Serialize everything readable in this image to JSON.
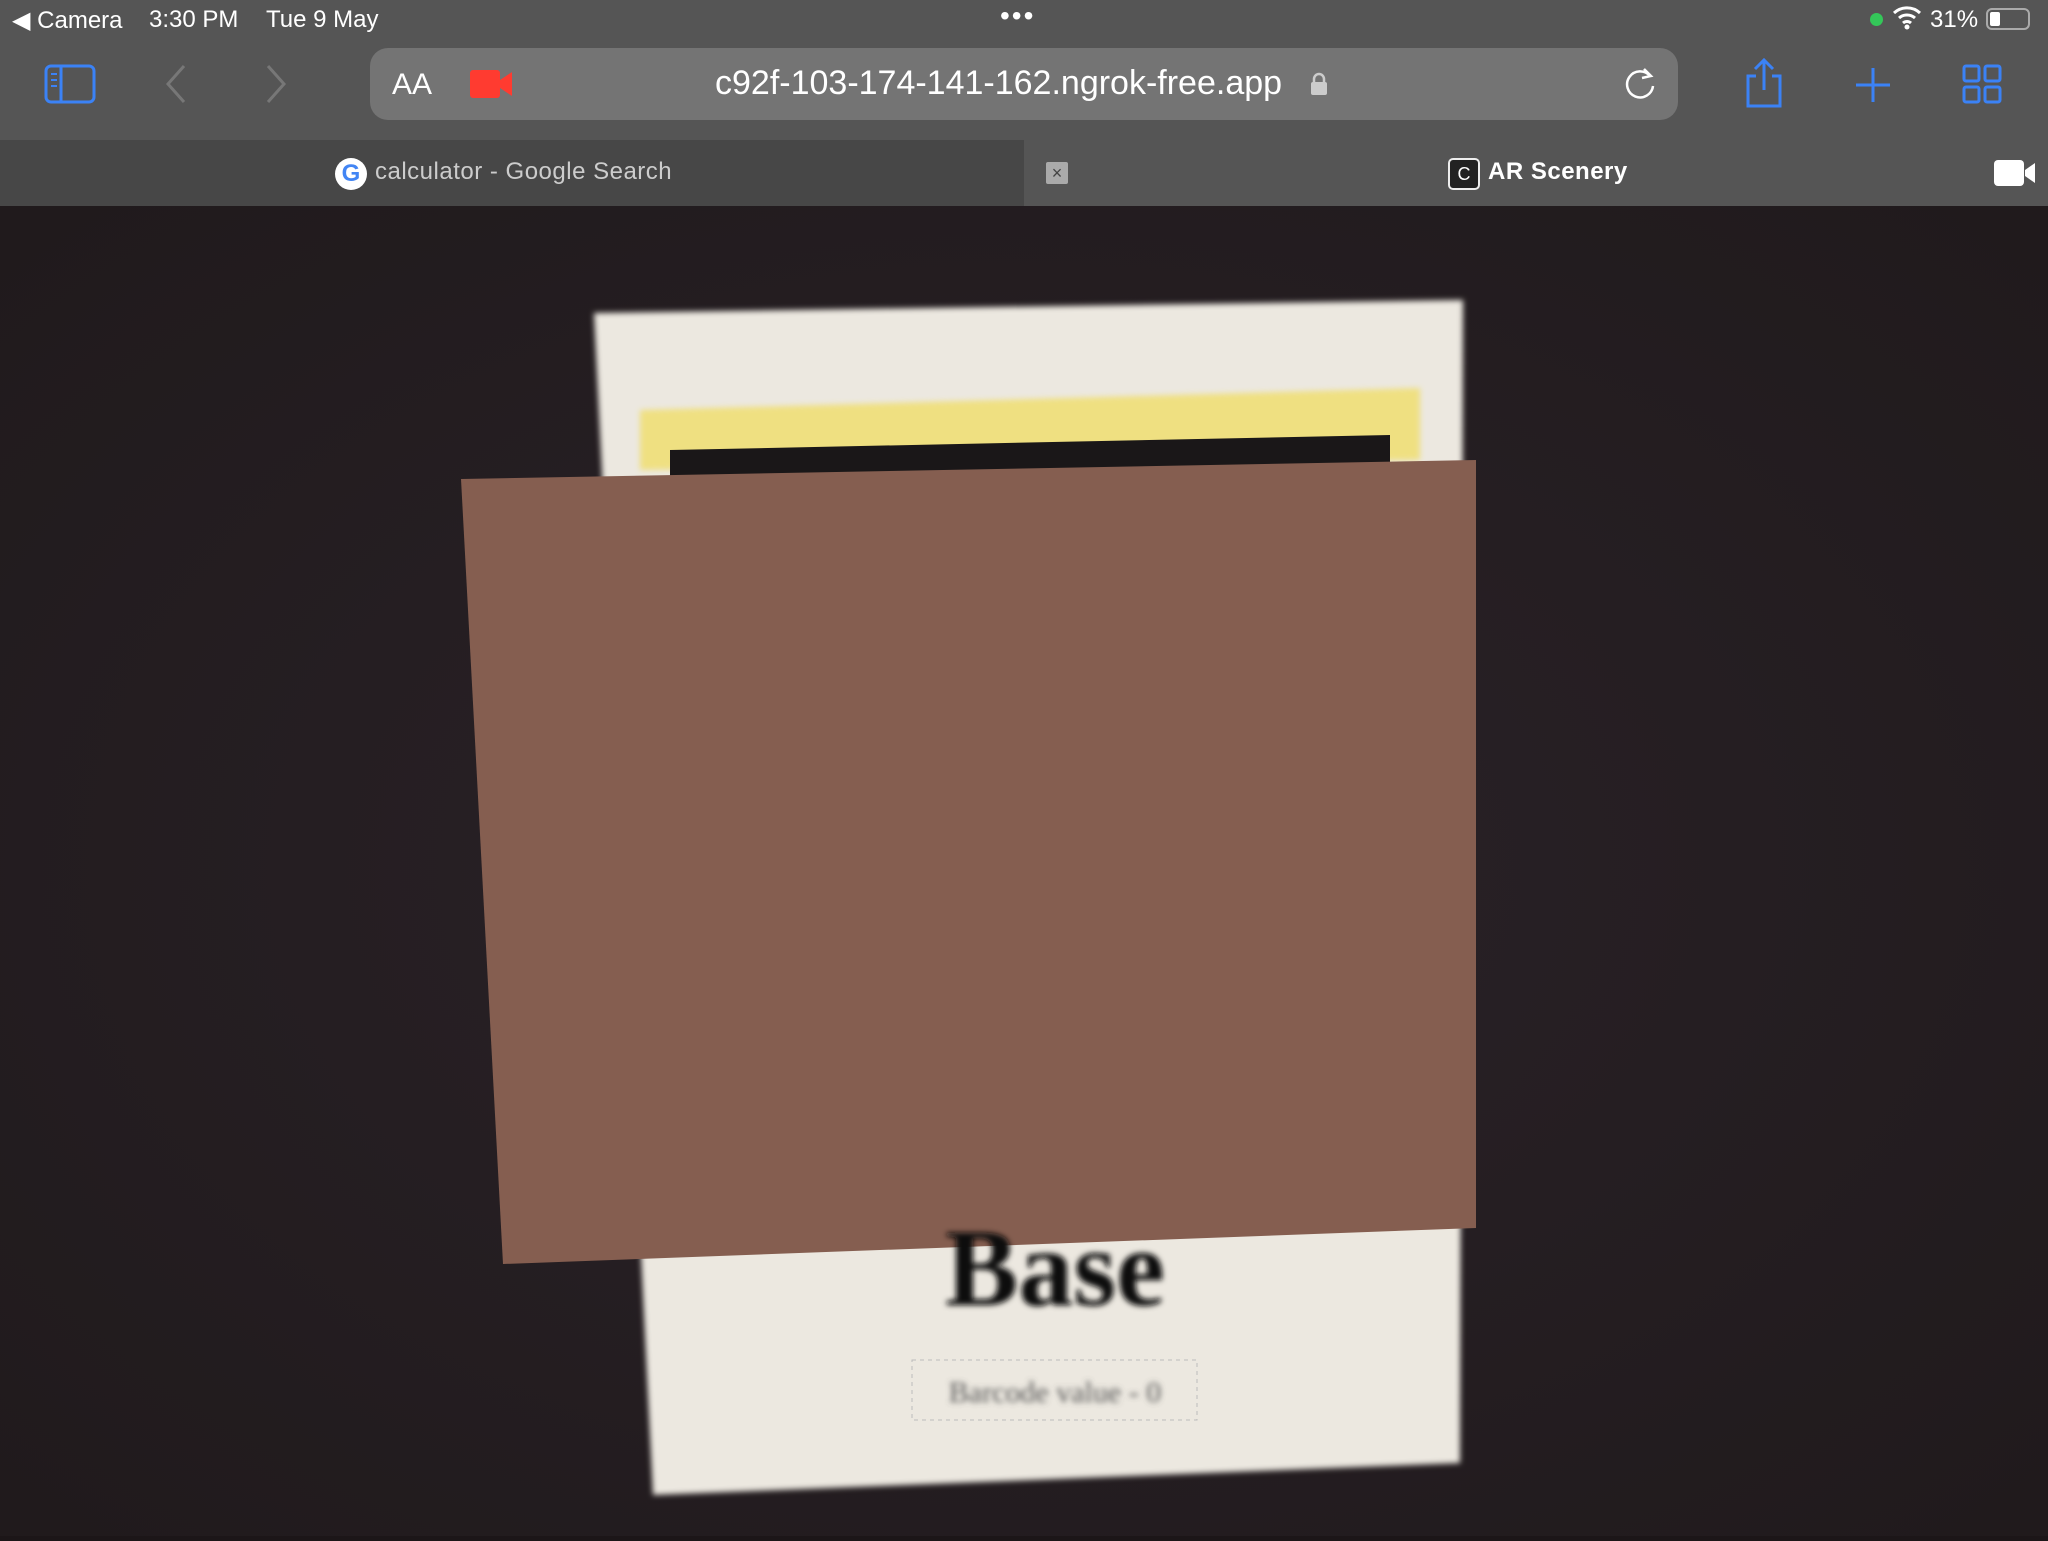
{
  "status_bar": {
    "back_app": "Camera",
    "time": "3:30 PM",
    "date": "Tue 9 May",
    "battery": "31%",
    "battery_level": 0.31
  },
  "toolbar": {
    "text_size_label": "AA",
    "url": "c92f-103-174-141-162.ngrok-free.app"
  },
  "tabs": [
    {
      "title": "calculator - Google Search",
      "active": true
    },
    {
      "title": "AR Scenery",
      "favicon_letter": "C",
      "active": false
    }
  ],
  "scene": {
    "marker_title": "Base",
    "barcode_label": "Barcode value - 0",
    "overlay_color": "#855e50"
  },
  "colors": {
    "accent": "#3b82f6",
    "recording": "#ff3b30"
  }
}
